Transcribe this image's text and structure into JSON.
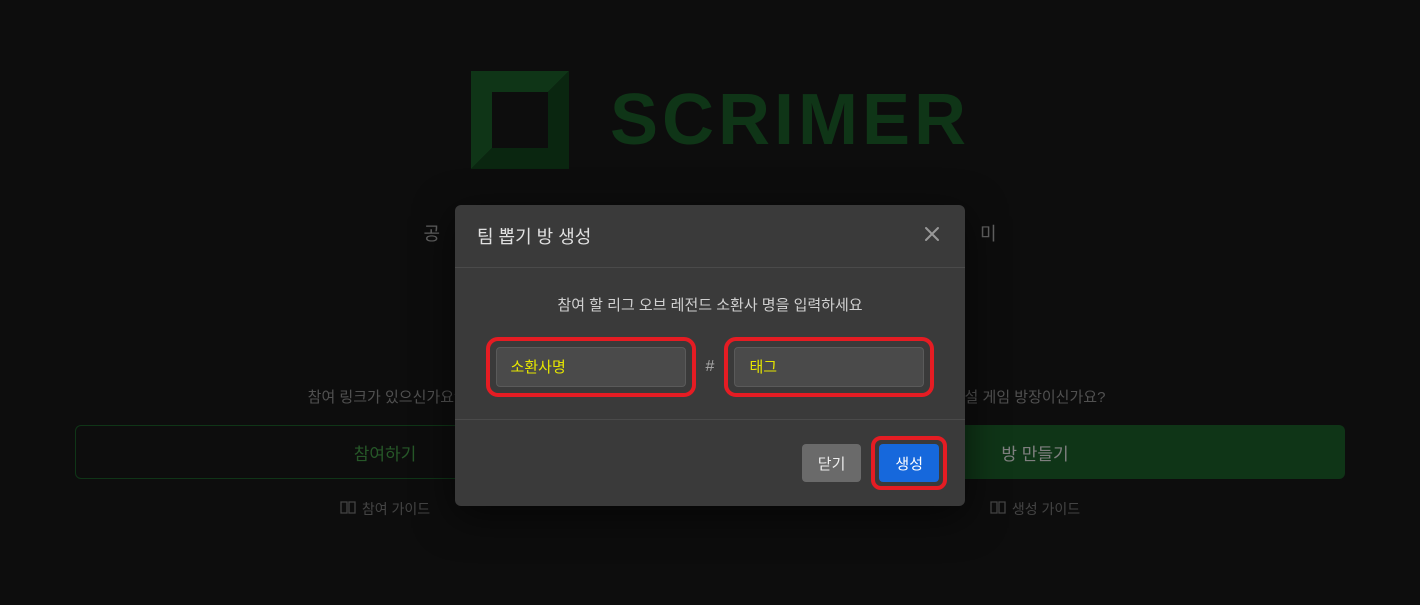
{
  "brand": {
    "name": "SCRIMER"
  },
  "tagline_left": "공",
  "tagline_right": "미",
  "cards": {
    "join": {
      "question": "참여 링크가 있으신가요?",
      "button": "참여하기",
      "guide": "참여 가이드"
    },
    "create": {
      "question": "설 게임 방장이신가요?",
      "button": "방 만들기",
      "guide": "생성 가이드"
    }
  },
  "modal": {
    "title": "팀 뽑기 방 생성",
    "instruction": "참여 할 리그 오브 레전드 소환사 명을 입력하세요",
    "summoner_placeholder": "소환사명",
    "separator": "#",
    "tag_placeholder": "태그",
    "close_label": "닫기",
    "create_label": "생성"
  }
}
